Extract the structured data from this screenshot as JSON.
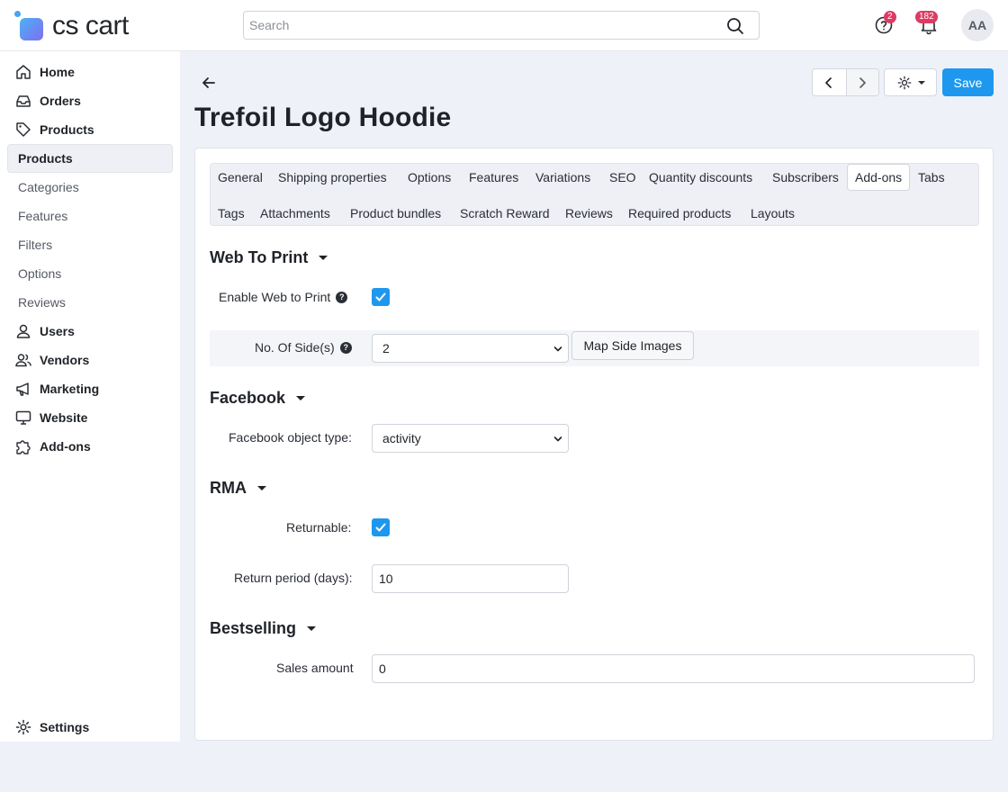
{
  "header": {
    "logo_text": "cs cart",
    "search_placeholder": "Search",
    "help_badge": "2",
    "notifications_badge": "182",
    "avatar_initials": "AA"
  },
  "sidebar": {
    "items": [
      {
        "label": "Home",
        "icon": "home-icon",
        "type": "main"
      },
      {
        "label": "Orders",
        "icon": "inbox-icon",
        "type": "main"
      },
      {
        "label": "Products",
        "icon": "tag-icon",
        "type": "main"
      },
      {
        "label": "Products",
        "type": "active"
      },
      {
        "label": "Categories",
        "type": "sub"
      },
      {
        "label": "Features",
        "type": "sub"
      },
      {
        "label": "Filters",
        "type": "sub"
      },
      {
        "label": "Options",
        "type": "sub"
      },
      {
        "label": "Reviews",
        "type": "sub"
      },
      {
        "label": "Users",
        "icon": "user-icon",
        "type": "main"
      },
      {
        "label": "Vendors",
        "icon": "users-icon",
        "type": "main"
      },
      {
        "label": "Marketing",
        "icon": "megaphone-icon",
        "type": "main"
      },
      {
        "label": "Website",
        "icon": "monitor-icon",
        "type": "main"
      },
      {
        "label": "Add-ons",
        "icon": "puzzle-icon",
        "type": "main"
      }
    ],
    "settings_label": "Settings"
  },
  "page": {
    "title": "Trefoil Logo Hoodie",
    "save_label": "Save"
  },
  "tabs": [
    "General",
    "Shipping properties",
    "Options",
    "Features",
    "Variations",
    "SEO",
    "Quantity discounts",
    "Subscribers",
    "Add-ons",
    "Tabs",
    "Tags",
    "Attachments",
    "Product bundles",
    "Scratch Reward",
    "Reviews",
    "Required products",
    "Layouts"
  ],
  "active_tab": "Add-ons",
  "web_to_print": {
    "title": "Web To Print",
    "enable_label": "Enable Web to Print",
    "enable_checked": true,
    "sides_label": "No. Of Side(s)",
    "sides_value": "2",
    "map_button": "Map Side Images"
  },
  "facebook": {
    "title": "Facebook",
    "object_type_label": "Facebook object type:",
    "object_type_value": "activity"
  },
  "rma": {
    "title": "RMA",
    "returnable_label": "Returnable:",
    "returnable_checked": true,
    "return_period_label": "Return period (days):",
    "return_period_value": "10"
  },
  "bestselling": {
    "title": "Bestselling",
    "sales_amount_label": "Sales amount",
    "sales_amount_value": "0"
  },
  "colors": {
    "accent": "#1e98ee",
    "badge": "#dc3b63"
  }
}
